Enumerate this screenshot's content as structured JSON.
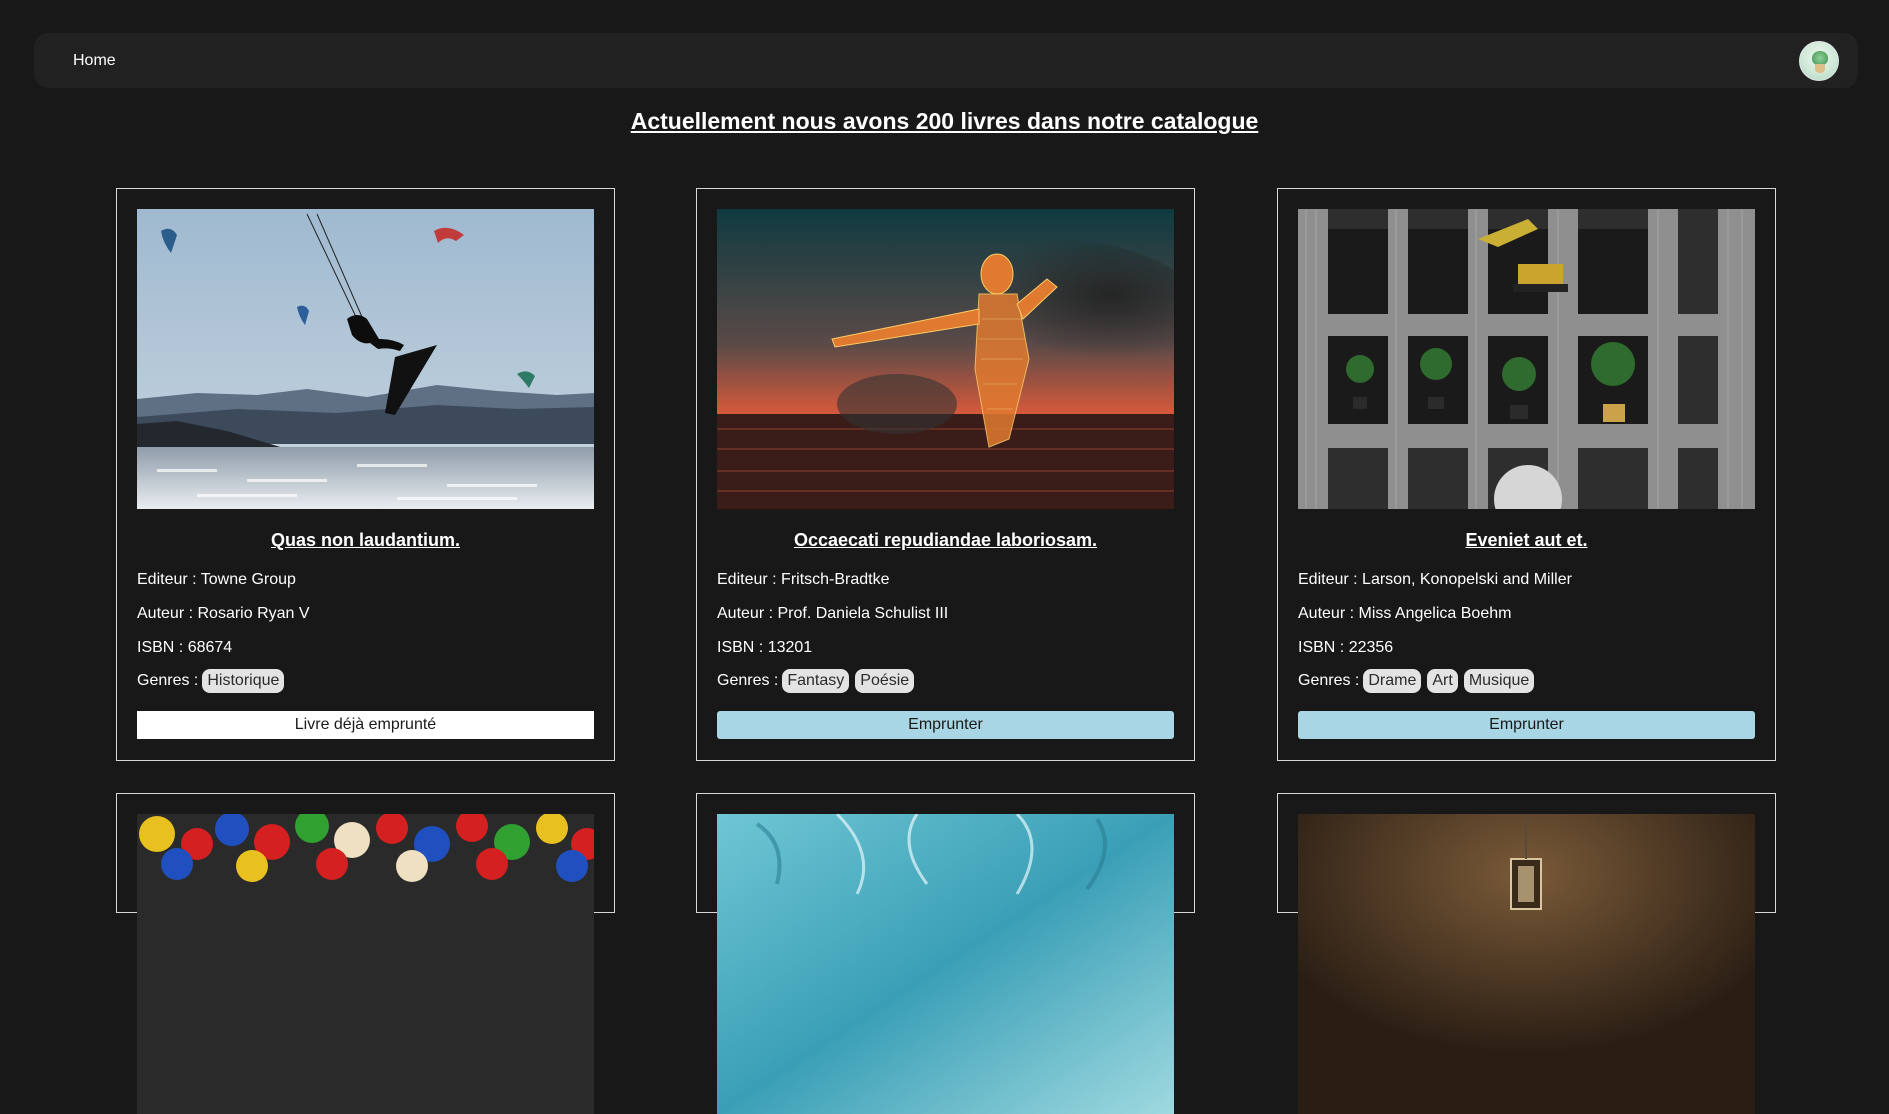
{
  "nav": {
    "home_label": "Home"
  },
  "page_title": "Actuellement nous avons 200 livres dans notre catalogue",
  "labels": {
    "editeur": "Editeur :",
    "auteur": "Auteur :",
    "isbn": "ISBN :",
    "genres": "Genres :"
  },
  "books": [
    {
      "title": "Quas non laudantium.",
      "editeur": "Towne Group",
      "auteur": "Rosario Ryan V",
      "isbn": "68674",
      "genres": [
        "Historique"
      ],
      "button_label": "Livre déjà emprunté",
      "available": false,
      "image": "kitesurfing-photo"
    },
    {
      "title": "Occaecati repudiandae laboriosam.",
      "editeur": "Fritsch-Bradtke",
      "auteur": "Prof. Daniela Schulist III",
      "isbn": "13201",
      "genres": [
        "Fantasy",
        "Poésie"
      ],
      "button_label": "Emprunter",
      "available": true,
      "image": "glowing-wire-figure-sunset-photo"
    },
    {
      "title": "Eveniet aut et.",
      "editeur": "Larson, Konopelski and Miller",
      "auteur": "Miss Angelica Boehm",
      "isbn": "22356",
      "genres": [
        "Drame",
        "Art",
        "Musique"
      ],
      "button_label": "Emprunter",
      "available": true,
      "image": "wooden-shelves-plants-photo"
    },
    {
      "image": "colorful-game-pieces-photo"
    },
    {
      "image": "turquoise-marble-cave-photo"
    },
    {
      "image": "dark-lantern-room-photo"
    }
  ],
  "colors": {
    "background": "#181818",
    "navbar": "#212121",
    "button_available": "#a9d6e4",
    "button_borrowed": "#ffffff",
    "genre_badge": "#e3e3e3"
  }
}
